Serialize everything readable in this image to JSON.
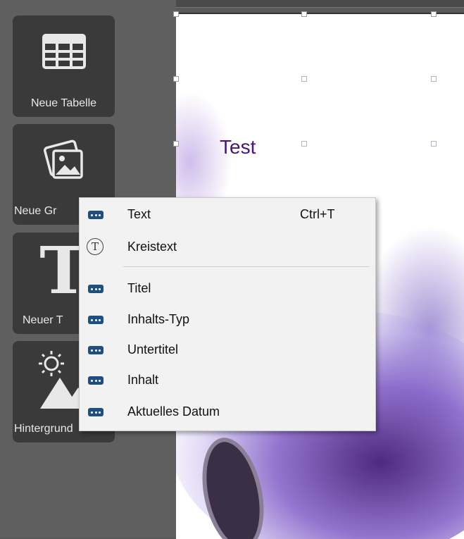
{
  "toolbar": {
    "items": [
      {
        "label": "Neue Tabelle",
        "icon": "table-icon"
      },
      {
        "label": "Neue Gr",
        "icon": "image-icon"
      },
      {
        "label": "Neuer T",
        "icon": "text-icon"
      },
      {
        "label": "Hintergrund",
        "icon": "background-icon"
      }
    ]
  },
  "page": {
    "text": "Test"
  },
  "context_menu": {
    "items": [
      {
        "label": "Text",
        "shortcut": "Ctrl+T",
        "icon": "placeholder-icon"
      },
      {
        "label": "Kreistext",
        "icon": "circle-text-icon"
      },
      {
        "label": "Titel",
        "icon": "placeholder-icon"
      },
      {
        "label": "Inhalts-Typ",
        "icon": "placeholder-icon"
      },
      {
        "label": "Untertitel",
        "icon": "placeholder-icon"
      },
      {
        "label": "Inhalt",
        "icon": "placeholder-icon"
      },
      {
        "label": "Aktuelles Datum",
        "icon": "placeholder-icon"
      }
    ]
  },
  "colors": {
    "panel": "#5f5f5f",
    "tool_bg": "#3a3a3a",
    "menu_bg": "#f2f2f2",
    "accent_icon": "#1f4f7f",
    "text_purple": "#4a1480"
  }
}
